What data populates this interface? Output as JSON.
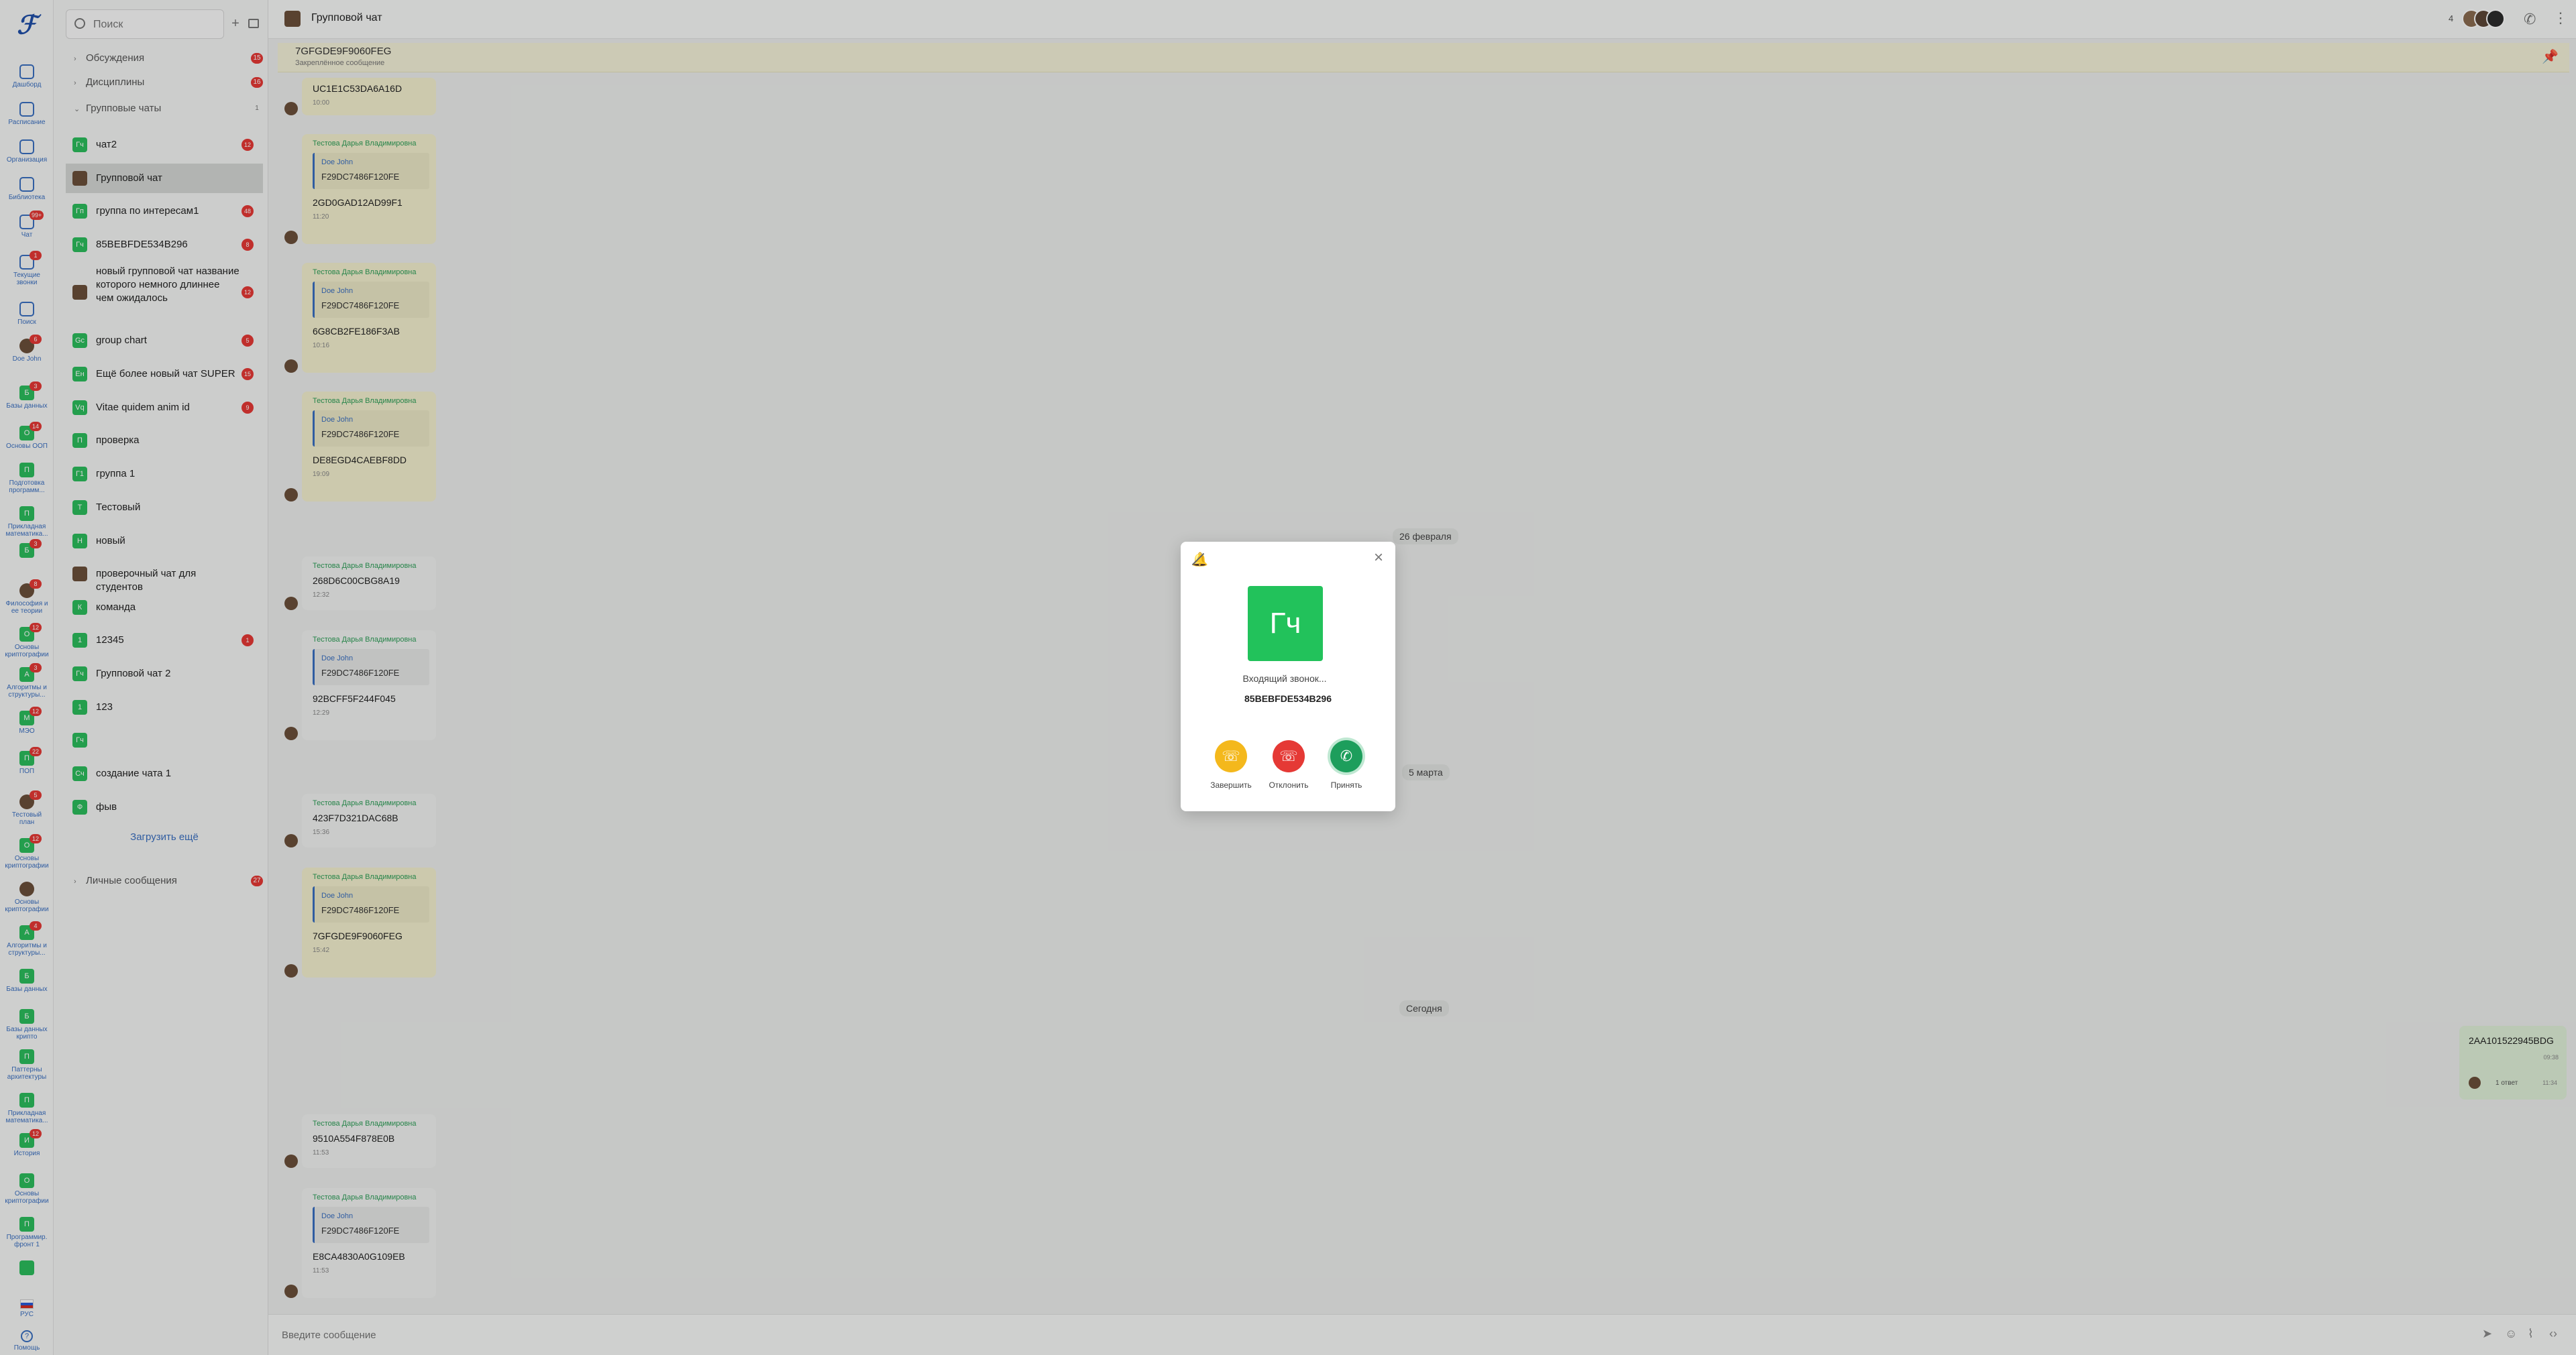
{
  "rail": {
    "items": [
      {
        "icon": "dashboard-icon",
        "label": "Дашборд"
      },
      {
        "icon": "schedule-icon",
        "label": "Расписание"
      },
      {
        "icon": "organization-icon",
        "label": "Организация"
      },
      {
        "icon": "library-icon",
        "label": "Библиотека"
      },
      {
        "icon": "chat-icon",
        "label": "Чат",
        "badge": "99+"
      },
      {
        "icon": "phone-icon",
        "label": "Текущие\nзвонки",
        "badge": "1"
      },
      {
        "icon": "search-icon",
        "label": "Поиск"
      },
      {
        "avatar": "photo",
        "label": "Doe John",
        "badge": "6"
      },
      {
        "avatar": "Б",
        "label": "Базы данных",
        "badge": "3"
      },
      {
        "avatar": "О",
        "label": "Основы ООП",
        "badge": "14"
      },
      {
        "avatar": "П",
        "label": "Подготовка\nпрограмм..."
      },
      {
        "avatar": "П",
        "label": "Прикладная\nматематика..."
      },
      {
        "avatar": "Б",
        "label": "",
        "badge": "3"
      },
      {
        "avatar": "photo",
        "label": "Философия и\nее теории",
        "badge": "8"
      },
      {
        "avatar": "О",
        "label": "Основы\nкриптографии",
        "badge": "12"
      },
      {
        "avatar": "А",
        "label": "Алгоритмы и\nструктуры...",
        "badge": "3"
      },
      {
        "avatar": "М",
        "label": "МЭО",
        "badge": "12"
      },
      {
        "avatar": "П",
        "label": "ПОП",
        "badge": "22"
      },
      {
        "avatar": "photo",
        "label": "Тестовый\nплан",
        "badge": "5"
      },
      {
        "avatar": "О",
        "label": "Основы\nкриптографии",
        "badge": "12"
      },
      {
        "avatar": "photo",
        "label": "Основы\nкриптографии"
      },
      {
        "avatar": "А",
        "label": "Алгоритмы и\nструктуры...",
        "badge": "4"
      },
      {
        "avatar": "Б",
        "label": "Базы данных"
      },
      {
        "avatar": "Б",
        "label": "Базы данных\nкрипто"
      },
      {
        "avatar": "П",
        "label": "Паттерны\nархитектуры"
      },
      {
        "avatar": "П",
        "label": "Прикладная\nматематика..."
      },
      {
        "avatar": "И",
        "label": "История",
        "badge": "12"
      },
      {
        "avatar": "О",
        "label": "Основы\nкриптографии"
      },
      {
        "avatar": "П",
        "label": "Программир.\nфронт 1"
      },
      {
        "avatar": "",
        "label": ""
      }
    ],
    "language": "РУС",
    "help": "Помощь"
  },
  "search": {
    "placeholder": "Поиск"
  },
  "sections": {
    "discussions": {
      "label": "Обсуждения",
      "badge": "15"
    },
    "disciplines": {
      "label": "Дисциплины",
      "badge": "16"
    },
    "group_chats": {
      "label": "Групповые чаты",
      "badge": "1"
    },
    "personal": {
      "label": "Личные сообщения",
      "badge": "27"
    }
  },
  "chats": [
    {
      "name": "чат2",
      "avatar": "Гч",
      "badge": "12",
      "active": false
    },
    {
      "name": "Групповой чат",
      "avatar": "photo",
      "badge": "",
      "active": true
    },
    {
      "name": "группа по интересам1",
      "avatar": "Гп",
      "badge": "48",
      "active": false
    },
    {
      "name": "85BEBFDE534B296",
      "avatar": "Гч",
      "badge": "8",
      "active": false
    },
    {
      "name": "новый групповой чат название которого немного длиннее чем ожидалось",
      "avatar": "photo",
      "badge": "12",
      "active": false
    },
    {
      "name": "group chart",
      "avatar": "Gc",
      "badge": "5",
      "active": false
    },
    {
      "name": "Ещё более новый чат SUPER",
      "avatar": "Ен",
      "badge": "15",
      "active": false
    },
    {
      "name": "Vitae quidem anim id",
      "avatar": "Vq",
      "badge": "9",
      "active": false
    },
    {
      "name": "проверка",
      "avatar": "П",
      "badge": "",
      "active": false
    },
    {
      "name": "группа 1",
      "avatar": "Г1",
      "badge": "",
      "active": false
    },
    {
      "name": "Тестовый",
      "avatar": "Т",
      "badge": "",
      "active": false
    },
    {
      "name": "новый",
      "avatar": "Н",
      "badge": "",
      "active": false
    },
    {
      "name": "проверочный чат для студентов",
      "avatar": "photo",
      "badge": "",
      "active": false
    },
    {
      "name": "команда",
      "avatar": "К",
      "badge": "",
      "active": false
    },
    {
      "name": "12345",
      "avatar": "1",
      "badge": "1",
      "active": false
    },
    {
      "name": "Групповой чат 2",
      "avatar": "Гч",
      "badge": "",
      "active": false
    },
    {
      "name": "123",
      "avatar": "1",
      "badge": "",
      "active": false
    },
    {
      "name": "",
      "avatar": "Гч",
      "badge": "",
      "active": false
    },
    {
      "name": "создание чата 1",
      "avatar": "Сч",
      "badge": "",
      "active": false
    },
    {
      "name": "фыв",
      "avatar": "Ф",
      "badge": "",
      "active": false
    }
  ],
  "load_more": "Загрузить ещё",
  "header": {
    "title": "Групповой чат",
    "member_count": "4"
  },
  "pinned": {
    "text": "7GFGDE9F9060FEG",
    "subtitle": "Закреплённое сообщение"
  },
  "messages": [
    {
      "text": "UC1E1C53DA6A16D",
      "time": "10:00"
    },
    {
      "sender": "Тестова Дарья Владимировна",
      "quote_name": "Doe John",
      "quote_text": "F29DC7486F120FE",
      "text": "2GD0GAD12AD99F1",
      "time": "11:20"
    },
    {
      "sender": "Тестова Дарья Владимировна",
      "quote_name": "Doe John",
      "quote_text": "F29DC7486F120FE",
      "text": "6G8CB2FE186F3AB",
      "time": "10:16"
    },
    {
      "sender": "Тестова Дарья Владимировна",
      "quote_name": "Doe John",
      "quote_text": "F29DC7486F120FE",
      "text": "DE8EGD4CAEBF8DD",
      "time": "19:09"
    },
    {
      "sender": "Тестова Дарья Владимировна",
      "text": "268D6C00CBG8A19",
      "time": "12:32"
    },
    {
      "sender": "Тестова Дарья Владимировна",
      "quote_name": "Doe John",
      "quote_text": "F29DC7486F120FE",
      "text": "92BCFF5F244F045",
      "time": "12:29"
    },
    {
      "sender": "Тестова Дарья Владимировна",
      "text": "423F7D321DAC68B",
      "time": "15:36"
    },
    {
      "sender": "Тестова Дарья Владимировна",
      "quote_name": "Doe John",
      "quote_text": "F29DC7486F120FE",
      "text": "7GFGDE9F9060FEG",
      "time": "15:42"
    },
    {
      "sender": "Тестова Дарья Владимировна",
      "text": "9510A554F878E0B",
      "time": "11:53"
    },
    {
      "sender": "Тестова Дарья Владимировна",
      "quote_name": "Doe John",
      "quote_text": "F29DC7486F120FE",
      "text": "E8CA4830A0G109EB",
      "time": "11:53"
    }
  ],
  "dates": [
    "26 февраля",
    "5 марта",
    "Сегодня"
  ],
  "outgoing": {
    "text": "2AA101522945BDG",
    "time": "09:38",
    "replies": "1 ответ",
    "reply_time": "11:34"
  },
  "input": {
    "placeholder": "Введите сообщение"
  },
  "call": {
    "avatar_initials": "Гч",
    "status": "Входящий звонок...",
    "caller": "85BEBFDE534B296",
    "end_label": "Завершить",
    "decline_label": "Отклонить",
    "accept_label": "Принять"
  },
  "colors": {
    "accent": "#3a6fc0",
    "green": "#22c25b",
    "accept": "#1d9e5c",
    "decline": "#e53935",
    "end": "#f4b81c",
    "quote_bg": "#f3f0cf"
  }
}
